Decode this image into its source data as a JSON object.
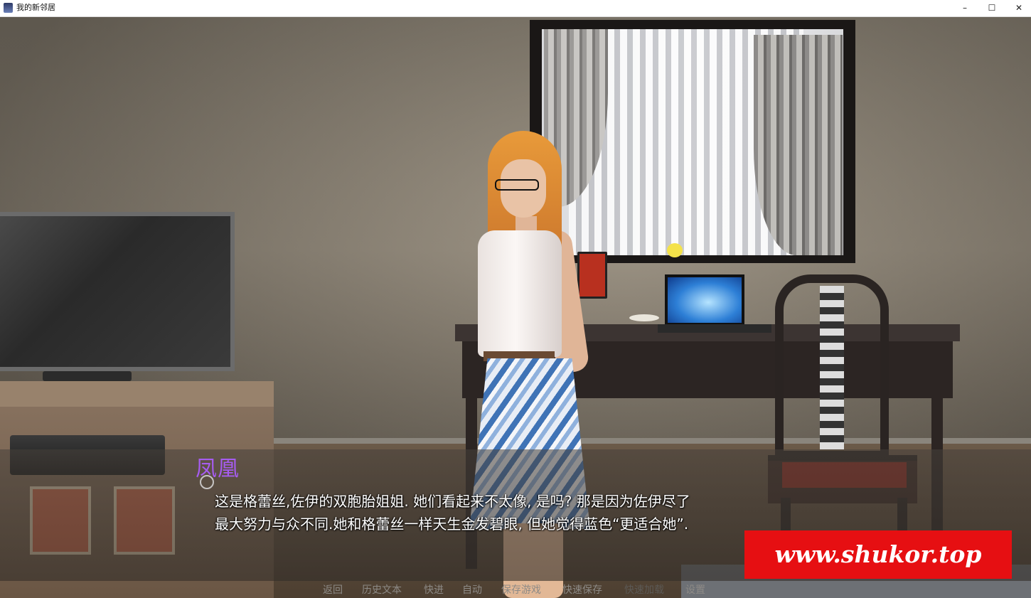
{
  "window": {
    "title": "我的新邻居",
    "minimize_glyph": "–",
    "maximize_glyph": "☐",
    "close_glyph": "✕",
    "icon": "app-icon"
  },
  "dialogue": {
    "speaker": "凤凰",
    "speaker_color": "#a65cf0",
    "lines": [
      "这是格蕾丝,佐伊的双胞胎姐姐. 她们看起来不太像, 是吗? 那是因为佐伊尽了",
      "最大努力与众不同.她和格蕾丝一样天生金发碧眼, 但她觉得蓝色“更适合她”."
    ]
  },
  "quick_menu": {
    "items": [
      {
        "label": "返回",
        "enabled": true
      },
      {
        "label": "历史文本",
        "enabled": true
      },
      {
        "label": "快进",
        "enabled": true
      },
      {
        "label": "自动",
        "enabled": true
      },
      {
        "label": "保存游戏",
        "enabled": true
      },
      {
        "label": "快速保存",
        "enabled": true
      },
      {
        "label": "快速加载",
        "enabled": false
      },
      {
        "label": "设置",
        "enabled": true
      }
    ]
  },
  "watermark": {
    "text": "www.shukor.top",
    "color": "#e60f12"
  }
}
